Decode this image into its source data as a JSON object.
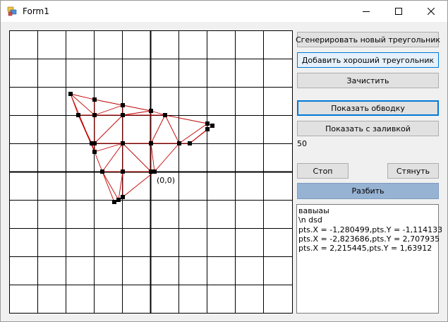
{
  "window": {
    "title": "Form1",
    "icons": {
      "app": "form-app-icon",
      "minimize": "minimize-icon",
      "maximize": "maximize-icon",
      "close": "close-icon"
    }
  },
  "buttons": {
    "generate": "Сгенерировать новый треугольник",
    "add_good": "Добавить хороший треугольник",
    "clear": "Зачистить",
    "show_outline": "Показать обводку",
    "show_fill": "Показать с заливкой",
    "stop": "Стоп",
    "pull": "Стянуть",
    "split": "Разбить"
  },
  "value_label": "50",
  "canvas": {
    "origin_label": "(0,0)",
    "colors": {
      "grid": "#000000",
      "edge": "#c00000",
      "point": "#000000"
    }
  },
  "log": {
    "lines": [
      "вавыаы",
      "\\n dsd",
      "pts.X = -1,280499,pts.Y = -1,114133",
      "pts.X = -2,823686,pts.Y = 2,707935",
      "pts.X = 2,215445,pts.Y = 1,63912"
    ]
  }
}
